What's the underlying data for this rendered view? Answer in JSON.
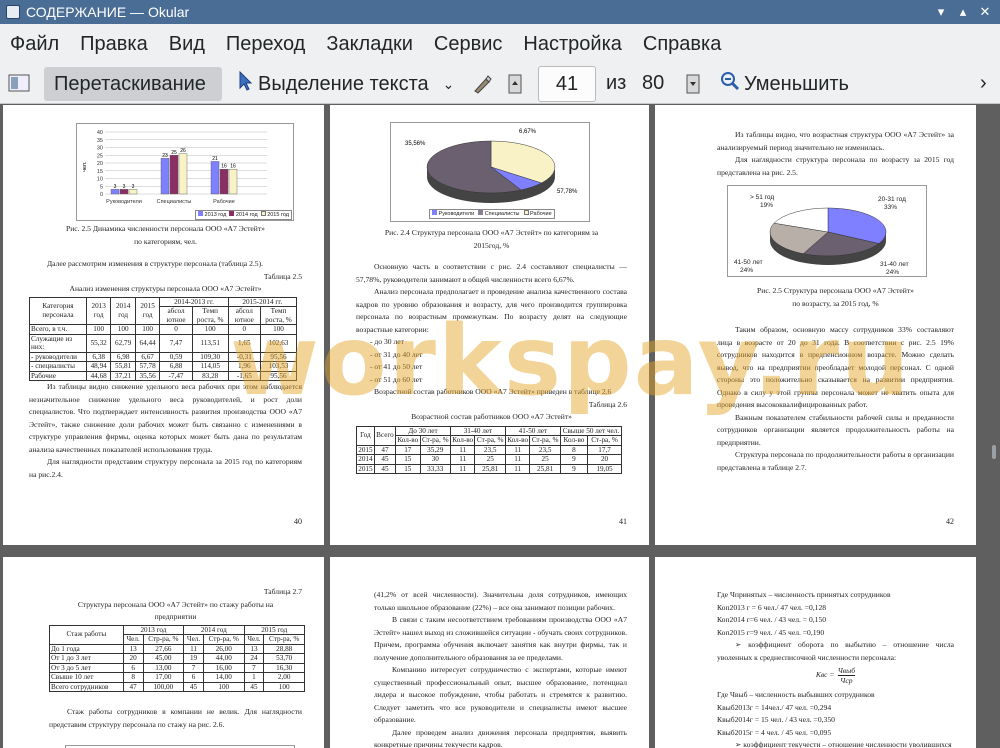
{
  "window": {
    "title": "СОДЕРЖАНИЕ  — Okular"
  },
  "menu": [
    "Файл",
    "Правка",
    "Вид",
    "Переход",
    "Закладки",
    "Сервис",
    "Настройка",
    "Справка"
  ],
  "toolbar": {
    "drag": "Перетаскивание",
    "select": "Выделение текста",
    "page": "41",
    "of": "из",
    "total": "80",
    "zoom_out": "Уменьшить"
  },
  "watermark": "workspay.ru",
  "p40": {
    "chart_y_label": "чел.",
    "chart_ticks": [
      "40",
      "35",
      "30",
      "25",
      "20",
      "15",
      "10",
      "5",
      "0"
    ],
    "chart_cats": [
      "Руководители",
      "Специалисты",
      "Рабочие"
    ],
    "chart_legend": [
      "2013 год",
      "2014 год",
      "2015 год"
    ],
    "chart_vals": [
      [
        "3",
        "3",
        "3"
      ],
      [
        "23",
        "25",
        "26"
      ],
      [
        "21",
        "16",
        "16"
      ]
    ],
    "cap1": "Рис. 2.5 Динамика численности персонала ООО «А7 Эстейт»",
    "cap2": "по категориям, чел.",
    "intro": "Далее рассмотрим изменения в структуре персонала (таблица 2.5).",
    "tnum": "Таблица 2.5",
    "ttitle": "Анализ изменения структуры персонала ООО «А7 Эстейт»",
    "th1": "Категория персонала",
    "th2": "2013 год",
    "th3": "2014 год",
    "th4": "2015 год",
    "th5": "2014-2013 гг.",
    "th6": "2015-2014 гг.",
    "thsub": [
      "абсол ютное",
      "Темп роста, %",
      "абсол ютное",
      "Темп роста, %"
    ],
    "rows": [
      [
        "Всего, в т.ч.",
        "100",
        "100",
        "100",
        "0",
        "100",
        "0",
        "100"
      ],
      [
        "Служащие из них:",
        "55,32",
        "62,79",
        "64,44",
        "7,47",
        "113,51",
        "1,65",
        "102,63"
      ],
      [
        "- руководители",
        "6,38",
        "6,98",
        "6,67",
        "0,59",
        "109,30",
        "-0,31",
        "95,56"
      ],
      [
        "- специалисты",
        "48,94",
        "55,81",
        "57,78",
        "6,88",
        "114,05",
        "1,96",
        "103,53"
      ],
      [
        "Рабочие",
        "44,68",
        "37,21",
        "35,56",
        "-7,47",
        "83,28",
        "-1,65",
        "95,56"
      ]
    ],
    "para1": "Из таблицы видно снижение удельного веса рабочих при этом наблюдается незначительное снижение удельного веса руководителей, и рост доли специалистов. Что подтверждает интенсивность развития производства ООО «А7 Эстейт», также снижение доли рабочих может быть связанно с изменениями в структуре управления фирмы, оценка которых может быть дана по результатам анализа качественных показателей использования труда.",
    "para2": "Для наглядности представим структуру персонала за 2015 год по категориям на рис.2.4.",
    "num": "40"
  },
  "p41": {
    "pie_labels": [
      "35,56%",
      "6,67%",
      "57,78%"
    ],
    "legend": [
      "Руководители",
      "Специалисты",
      "Рабочие"
    ],
    "cap1": "Рис. 2.4 Структура персонала ООО «А7 Эстейт» по категориям за",
    "cap2": "2015год, %",
    "para1": "Основную часть в соответствии с рис. 2.4 составляют специалисты — 57,78%, руководители занимают в общей численности всего 6,67%.",
    "para2": "Анализ персонала предполагает и проведение анализа качественного состава кадров по уровню образования и возрасту, для чего производится группировка персонала по возрастным промежуткам. По возрасту делят на следующие возрастные категории:",
    "list": [
      "- до 30 лет",
      "- от 31 до 40 лет",
      "- от 41 до 50 лет",
      "- от 51 до 60 лет"
    ],
    "para3": "Возрастной состав работников ООО «А7 Эстейт» приведен в таблице 2.6",
    "tnum": "Таблица 2.6",
    "ttitle": "Возрастной состав работников ООО «А7 Эстейт»",
    "h_year": "Год",
    "h_total": "Всего",
    "h_groups": [
      "До 30 лет",
      "31-40 лет",
      "41-50 лет",
      "Свыше 50 лет чел."
    ],
    "h_sub": [
      "Кол-во",
      "Ст-ра, %",
      "Кол-во",
      "Ст-ра, %",
      "Кол-во",
      "Ст-ра, %",
      "Кол-во",
      "Ст-ра, %"
    ],
    "rows": [
      [
        "2015",
        "47",
        "17",
        "35,29",
        "11",
        "23,5",
        "11",
        "23,5",
        "8",
        "17,7"
      ],
      [
        "2014",
        "45",
        "15",
        "30",
        "11",
        "25",
        "11",
        "25",
        "9",
        "20"
      ],
      [
        "2015",
        "45",
        "15",
        "33,33",
        "11",
        "25,81",
        "11",
        "25,81",
        "9",
        "19,05"
      ]
    ],
    "num": "41"
  },
  "p42": {
    "para1": "Из таблицы видно, что возрастная структура ООО «А7 Эстейт» за анализируемый период значительно не изменилась.",
    "para2": "Для наглядности структура персонала по возрасту за 2015 год представлена на рис. 2.5.",
    "pie_labels": [
      "> 51 год",
      "19%",
      "20-31 год",
      "33%",
      "41-50 лет",
      "24%",
      "31-40 лет",
      "24%"
    ],
    "cap1": "Рис. 2.5 Структура персонала ООО «А7 Эстейт»",
    "cap2": "по возрасту, за 2015 год, %",
    "para3": "Таким образом, основную массу сотрудников 33% составляют лица в возрасте от 20 до 31 года. В соответствии с рис. 2.5 19% сотрудников находится в предпенсионном возрасте. Можно сделать вывод, что на предприятии преобладает молодой персонал. С одной стороны это положительно сказывается на развитии предприятия. Однако в силу у этой группы персонала может не хватить опыта для проведения высококвалифицированных работ.",
    "para4": "Важным показателем стабильности рабочей силы и преданности сотрудников организации является продолжительность работы на предприятии.",
    "para5": "Структура персонала по продолжительности работы в организации представлена в таблице 2.7.",
    "num": "42"
  },
  "p43": {
    "tnum": "Таблица 2.7",
    "ttitle1": "Структура персонала ООО «А7 Эстейт» по стажу работы на",
    "ttitle2": "предприятии",
    "h_stage": "Стаж работы",
    "h_years": [
      "2013 год",
      "2014 год",
      "2015 год"
    ],
    "h_sub": [
      "Чел.",
      "Стр-ра, %",
      "Чел.",
      "Стр-ра, %",
      "Чел.",
      "Стр-ра, %"
    ],
    "rows": [
      [
        "До 1 года",
        "13",
        "27,66",
        "11",
        "26,00",
        "13",
        "28,88"
      ],
      [
        "От 1 до 3 лет",
        "20",
        "45,00",
        "19",
        "44,00",
        "24",
        "53,70"
      ],
      [
        "От 3 до 5 лет",
        "6",
        "13,00",
        "7",
        "16,00",
        "7",
        "16,30"
      ],
      [
        "Свыше 10 лет",
        "8",
        "17,00",
        "6",
        "14,00",
        "1",
        "2,00"
      ],
      [
        "Всего сотрудников",
        "47",
        "100,00",
        "45",
        "100",
        "45",
        "100"
      ]
    ],
    "para1": "Стаж работы сотрудников в компании не велик. Для наглядности представим структуру персонала по стажу на рис. 2.6."
  },
  "p44": {
    "para1": "(41,2% от всей численности). Значительна доля сотрудников, имеющих только школьное образование (22%) – все она занимают позиции рабочих.",
    "para2": "В связи с таким несоответствием требованиям производства ООО «А7 Эстейт» нашел выход из сложившейся ситуации - обучать своих сотрудников. Причем, программа обучения включает занятия как внутри фирмы, так и получение дополнительного образования за ее пределами.",
    "para3": "Компанию интересует сотрудничество с экспертами, которые имеют существенный профессиональный опыт, высшее образование, потенциал лидера и высокое побуждение, чтобы работать и стремятся к развитию. Следует заметить что все руководители и специалисты имеют высшее образование.",
    "para4": "Далее проведем анализ движения персонала предприятия, выявить конкретные причины текучести кадров."
  },
  "p45": {
    "lines": [
      "Где Чпринятых – численность принятых сотрудников",
      "Коп2013 г = 6 чел./ 47 чел. =0,128",
      "Коп2014 г=6 чел. / 43 чел. = 0,150",
      "Коп2015 г=9 чел. / 45 чел. =0,190"
    ],
    "bullet1": "коэффициент оборота по выбытию – отношение числа уволенных к среднесписочной численности персонала:",
    "formula_l": "Квс =",
    "formula_n": "Чвыб",
    "formula_d": "Чср",
    "lines2": [
      "Где Чвыб – численность выбывших сотрудников",
      "Квыб2013г = 14чел./ 47 чел. =0,294",
      "Квыб2014г = 15 чел. / 43 чел. =0,350",
      "Квыб2015г = 4 чел. / 45 чел. =0,095"
    ],
    "bullet2": "коэффициент текучести – отношение численности уволившихся"
  }
}
